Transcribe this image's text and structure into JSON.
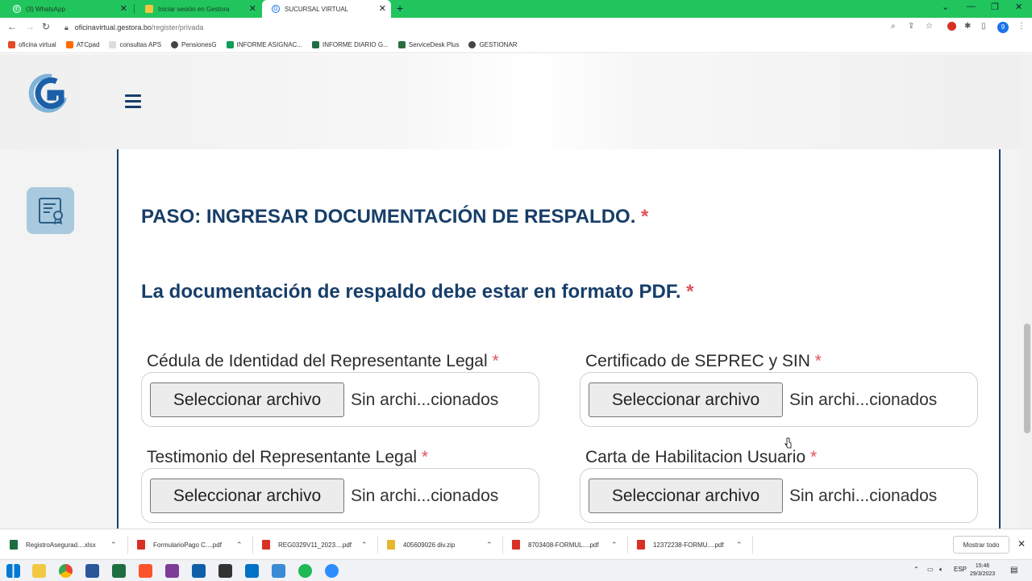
{
  "browser": {
    "tabs": [
      {
        "label": "(3) WhatsApp",
        "active": false
      },
      {
        "label": "Iniciar sesión en Gestora",
        "active": false
      },
      {
        "label": "SUCURSAL VIRTUAL",
        "active": true
      }
    ],
    "new_tab": "+",
    "url_host": "oficinavirtual.gestora.bo",
    "url_path": "/register/privada",
    "profile_initial": "9",
    "bookmarks": [
      {
        "label": "oficina virtual",
        "color": "#e34c26"
      },
      {
        "label": "ATCpad",
        "color": "#ff6a00"
      },
      {
        "label": "consultas APS",
        "color": "#cccccc"
      },
      {
        "label": "PensionesG",
        "color": "#444444"
      },
      {
        "label": "INFORME ASIGNAC...",
        "color": "#0f9d58"
      },
      {
        "label": "INFORME DIARIO G...",
        "color": "#1d6f42"
      },
      {
        "label": "ServiceDesk Plus",
        "color": "#2a6e3f"
      },
      {
        "label": "GESTIONAR",
        "color": "#444444"
      }
    ]
  },
  "page": {
    "step_title": "PASO: INGRESAR DOCUMENTACIÓN DE RESPALDO.",
    "format_note": "La documentación de respaldo debe estar en formato PDF.",
    "required_mark": "*",
    "fields": [
      {
        "label": "Cédula de Identidad del Representante Legal",
        "button": "Seleccionar archivo",
        "status": "Sin archi...cionados"
      },
      {
        "label": "Certificado de SEPREC y SIN",
        "button": "Seleccionar archivo",
        "status": "Sin archi...cionados"
      },
      {
        "label": "Testimonio del Representante Legal",
        "button": "Seleccionar archivo",
        "status": "Sin archi...cionados"
      },
      {
        "label": "Carta de Habilitacion Usuario",
        "button": "Seleccionar archivo",
        "status": "Sin archi...cionados"
      }
    ]
  },
  "downloads": {
    "items": [
      {
        "name": "RegistroAsegurad....xlsx",
        "color": "#1d6f42"
      },
      {
        "name": "FormularioPago C....pdf",
        "color": "#d93025"
      },
      {
        "name": "REG0329V11_2023....pdf",
        "color": "#d93025"
      },
      {
        "name": "405609026 div.zip",
        "color": "#e8b62e"
      },
      {
        "name": "8703408-FORMUL....pdf",
        "color": "#d93025"
      },
      {
        "name": "12372238-FORMU....pdf",
        "color": "#d93025"
      }
    ],
    "show_all": "Mostrar todo"
  },
  "taskbar": {
    "language": "ESP",
    "time": "15:46",
    "date": "29/3/2023"
  }
}
